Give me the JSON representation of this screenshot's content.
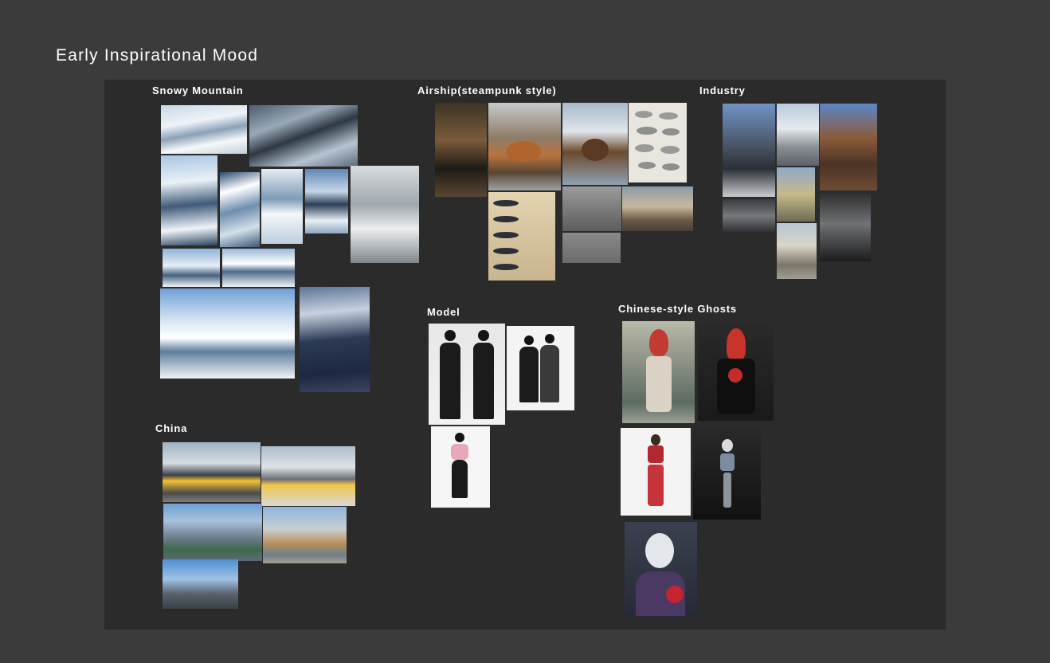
{
  "page": {
    "title": "Early Inspirational Mood"
  },
  "sections": {
    "snowy_mountain": "Snowy Mountain",
    "airship": "Airship(steampunk style)",
    "industry": "Industry",
    "model": "Model",
    "chinese_ghosts": "Chinese-style Ghosts",
    "china": "China"
  },
  "colors": {
    "page_background": "#3b3b3b",
    "board_background": "#2b2b2b",
    "text": "#ffffff"
  }
}
